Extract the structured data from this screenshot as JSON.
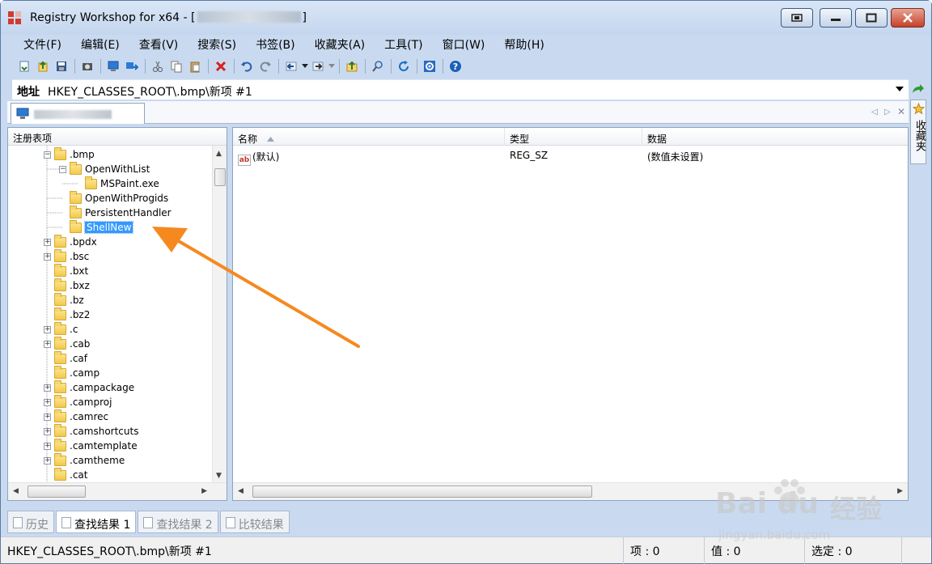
{
  "window": {
    "title_prefix": "Registry Workshop for x64 - [",
    "title_suffix": "]"
  },
  "menu": [
    "文件(F)",
    "编辑(E)",
    "查看(V)",
    "搜索(S)",
    "书签(B)",
    "收藏夹(A)",
    "工具(T)",
    "窗口(W)",
    "帮助(H)"
  ],
  "address": {
    "label": "地址",
    "value": "HKEY_CLASSES_ROOT\\.bmp\\新项 #1"
  },
  "favorites_tab": "收藏夹",
  "left_pane": {
    "header": "注册表项",
    "tree": [
      {
        "label": ".bmp",
        "expander": "−",
        "indent": 0
      },
      {
        "label": "OpenWithList",
        "expander": "−",
        "indent": 1
      },
      {
        "label": "MSPaint.exe",
        "expander": "",
        "indent": 2
      },
      {
        "label": "OpenWithProgids",
        "expander": "",
        "indent": 1
      },
      {
        "label": "PersistentHandler",
        "expander": "",
        "indent": 1
      },
      {
        "label": "ShellNew",
        "expander": "",
        "indent": 1,
        "selected": true
      },
      {
        "label": ".bpdx",
        "expander": "+",
        "indent": 0
      },
      {
        "label": ".bsc",
        "expander": "+",
        "indent": 0
      },
      {
        "label": ".bxt",
        "expander": "",
        "indent": 0
      },
      {
        "label": ".bxz",
        "expander": "",
        "indent": 0
      },
      {
        "label": ".bz",
        "expander": "",
        "indent": 0
      },
      {
        "label": ".bz2",
        "expander": "",
        "indent": 0
      },
      {
        "label": ".c",
        "expander": "+",
        "indent": 0
      },
      {
        "label": ".cab",
        "expander": "+",
        "indent": 0
      },
      {
        "label": ".caf",
        "expander": "",
        "indent": 0
      },
      {
        "label": ".camp",
        "expander": "",
        "indent": 0
      },
      {
        "label": ".campackage",
        "expander": "+",
        "indent": 0
      },
      {
        "label": ".camproj",
        "expander": "+",
        "indent": 0
      },
      {
        "label": ".camrec",
        "expander": "+",
        "indent": 0
      },
      {
        "label": ".camshortcuts",
        "expander": "+",
        "indent": 0
      },
      {
        "label": ".camtemplate",
        "expander": "+",
        "indent": 0
      },
      {
        "label": ".camtheme",
        "expander": "+",
        "indent": 0
      },
      {
        "label": ".cat",
        "expander": "",
        "indent": 0
      }
    ]
  },
  "right_pane": {
    "columns": [
      "名称",
      "类型",
      "数据"
    ],
    "rows": [
      {
        "icon": "ab",
        "name": "(默认)",
        "type": "REG_SZ",
        "data": "(数值未设置)"
      }
    ]
  },
  "bottom_tabs": [
    {
      "label": "历史",
      "active": false
    },
    {
      "label": "查找结果 1",
      "active": true
    },
    {
      "label": "查找结果 2",
      "active": false
    },
    {
      "label": "比较结果",
      "active": false
    }
  ],
  "status": {
    "path": "HKEY_CLASSES_ROOT\\.bmp\\新项 #1",
    "items": "项 : 0",
    "values": "值 : 0",
    "selected": "选定 : 0"
  },
  "watermark": {
    "brand": "Bai  du",
    "brand_cn": "经验",
    "url": "jingyan.baidu.com"
  },
  "colors": {
    "selection": "#3399ff",
    "annotation_arrow": "#f5891f",
    "close_button": "#c5412a"
  }
}
